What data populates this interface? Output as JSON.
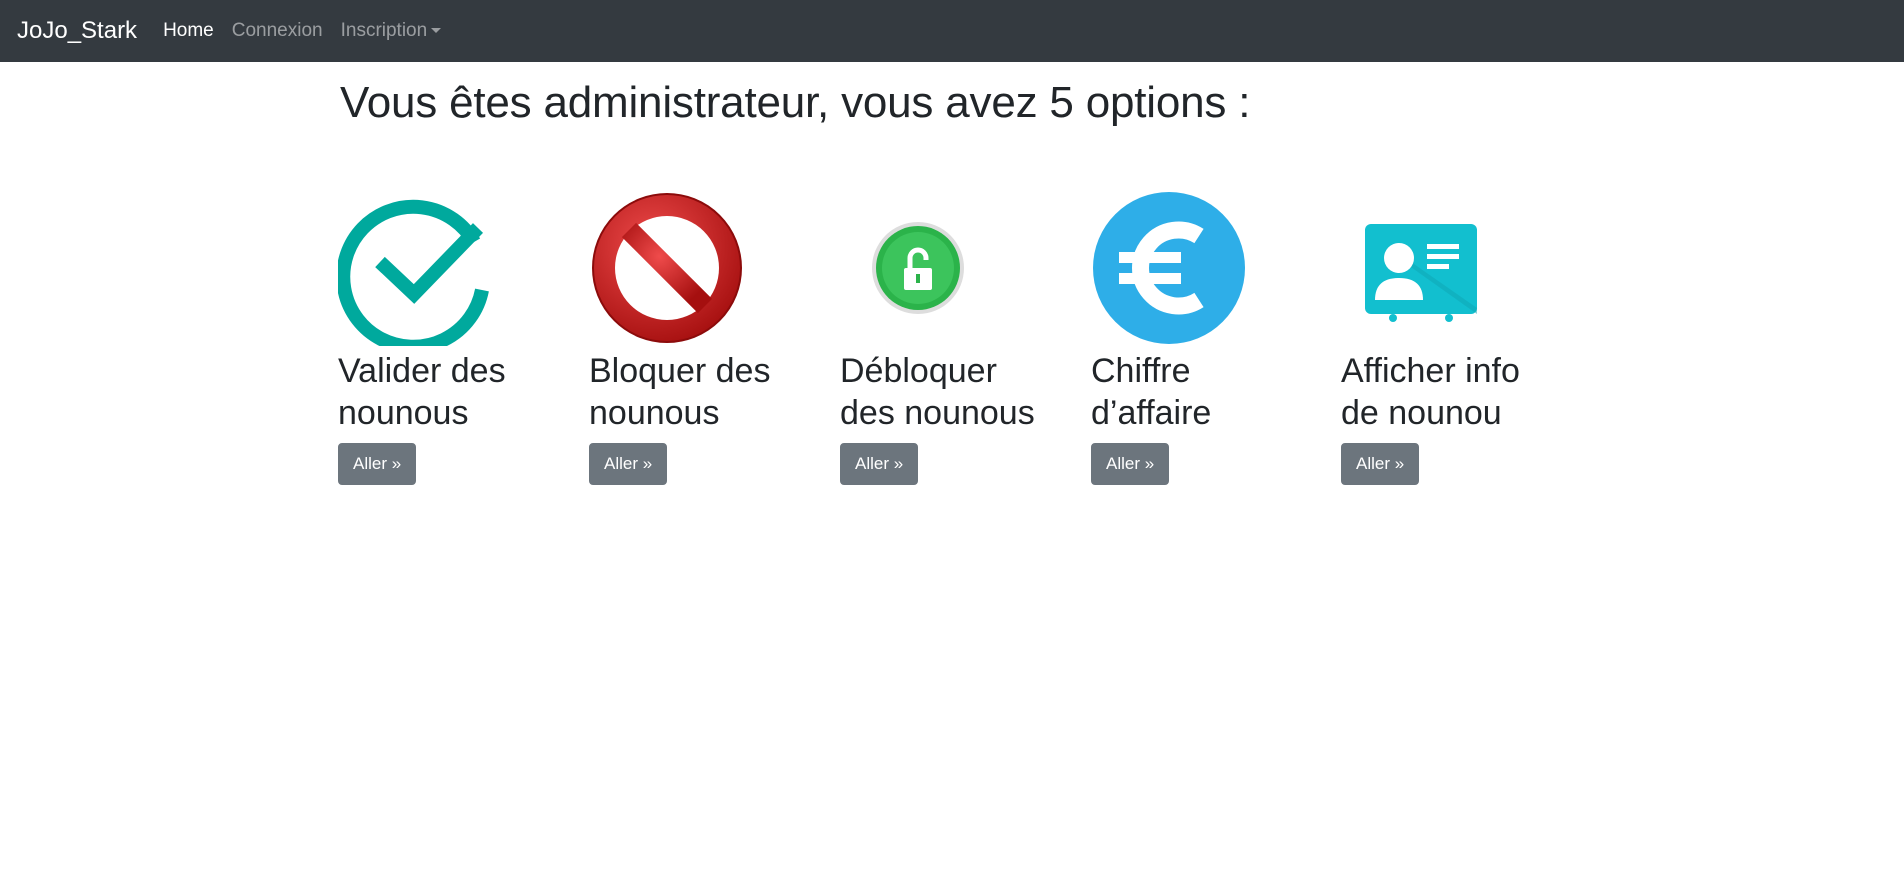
{
  "navbar": {
    "brand": "JoJo_Stark",
    "links": [
      {
        "label": "Home"
      },
      {
        "label": "Connexion"
      },
      {
        "label": "Inscription"
      }
    ]
  },
  "main": {
    "title": "Vous êtes administrateur, vous avez 5 options :",
    "options": [
      {
        "title_line1": "Valider des",
        "title_line2": "nounous",
        "button": "Aller »",
        "icon": "check-circle-icon"
      },
      {
        "title_line1": "Bloquer des",
        "title_line2": "nounous",
        "button": "Aller »",
        "icon": "block-sign-icon"
      },
      {
        "title_line1": "Débloquer",
        "title_line2": "des nounous",
        "button": "Aller »",
        "icon": "unlock-icon"
      },
      {
        "title_line1": "Chiffre",
        "title_line2": "d’affaire",
        "button": "Aller »",
        "icon": "euro-icon"
      },
      {
        "title_line1": "Afficher info",
        "title_line2": "de nounou",
        "button": "Aller »",
        "icon": "id-card-icon"
      }
    ]
  },
  "colors": {
    "navbar_bg": "#343a40",
    "check_teal": "#00a99d",
    "block_red": "#cc1f1f",
    "unlock_green": "#2bb34a",
    "euro_blue": "#2eaee8",
    "idcard_cyan": "#12bfcf",
    "button_gray": "#6c757d"
  }
}
